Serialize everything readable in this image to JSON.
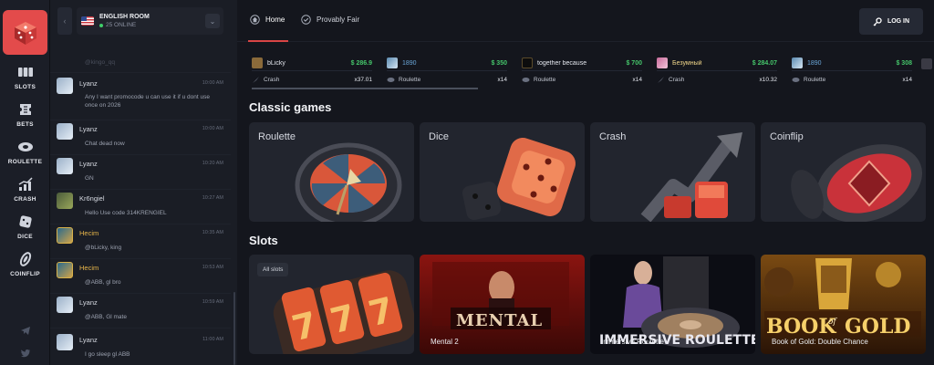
{
  "rail": {
    "items": [
      {
        "label": "SLOTS",
        "icon": "slots-icon"
      },
      {
        "label": "BETS",
        "icon": "ticket-icon"
      },
      {
        "label": "ROULETTE",
        "icon": "roulette-icon"
      },
      {
        "label": "CRASH",
        "icon": "crash-chart-icon"
      },
      {
        "label": "DICE",
        "icon": "dice-icon"
      },
      {
        "label": "COINFLIP",
        "icon": "coinflip-icon"
      }
    ],
    "social": [
      "telegram-icon",
      "twitter-icon"
    ]
  },
  "chat": {
    "room_name": "ENGLISH ROOM",
    "online": "25 ONLINE",
    "messages": [
      {
        "user": "",
        "time": "",
        "text": "@kingo_qq"
      },
      {
        "user": "Lyanz",
        "time": "10:00 AM",
        "text": "Any I want promocode u can use it if u dont use once on 2026"
      },
      {
        "user": "Lyanz",
        "time": "10:00 AM",
        "text": "Chat dead now"
      },
      {
        "user": "Lyanz",
        "time": "10:20 AM",
        "text": "GN"
      },
      {
        "user": "Kr6ngiel",
        "time": "10:27 AM",
        "text": "Hello Use code 314KRENGIEL"
      },
      {
        "user": "Hecim",
        "time": "10:35 AM",
        "text": "@bLicky, king"
      },
      {
        "user": "Hecim",
        "time": "10:53 AM",
        "text": "@ABB, gl bro"
      },
      {
        "user": "Lyanz",
        "time": "10:59 AM",
        "text": "@ABB, Gl mate"
      },
      {
        "user": "Lyanz",
        "time": "11:00 AM",
        "text": "I go sleep gl ABB"
      }
    ]
  },
  "nav": {
    "home": "Home",
    "fair": "Provably Fair",
    "login": "LOG IN"
  },
  "bets": [
    {
      "user": "bLicky",
      "amount": "$ 286.9",
      "game": "Crash",
      "mult": "x37.01",
      "color": "#8a6a3a"
    },
    {
      "user": "1890",
      "amount": "$ 350",
      "game": "Roulette",
      "mult": "x14",
      "color": "#5a8ab0"
    },
    {
      "user": "together because",
      "amount": "$ 700",
      "game": "Roulette",
      "mult": "x14",
      "color": "#1a1a1a"
    },
    {
      "user": "Безумный",
      "amount": "$ 284.07",
      "game": "Crash",
      "mult": "x10.32",
      "color": "#c86a9a"
    },
    {
      "user": "1890",
      "amount": "$ 308",
      "game": "Roulette",
      "mult": "x14",
      "color": "#5a8ab0"
    },
    {
      "user": "",
      "amount": "",
      "game": "",
      "mult": "",
      "color": "#3a3a44"
    }
  ],
  "sections": {
    "classic": "Classic games",
    "slots": "Slots"
  },
  "classic_games": [
    "Roulette",
    "Dice",
    "Crash",
    "Coinflip"
  ],
  "slots": {
    "all_slots": "All slots",
    "games": [
      "Mental 2",
      "Immersive Roulette",
      "Book of Gold: Double Chance"
    ]
  }
}
